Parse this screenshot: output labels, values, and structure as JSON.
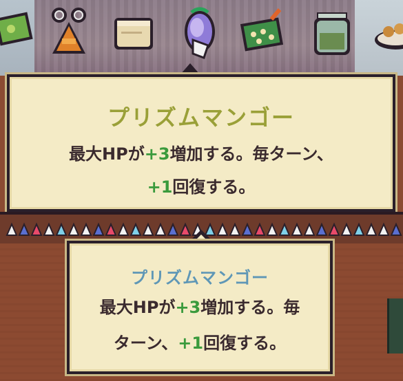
{
  "items": [
    {
      "name": "green-card-icon"
    },
    {
      "name": "scissors-ticket-icon"
    },
    {
      "name": "parchment-scroll-icon"
    },
    {
      "name": "prism-mango-icon"
    },
    {
      "name": "flower-blanket-icon"
    },
    {
      "name": "jar-icon"
    },
    {
      "name": "cookie-plate-icon"
    }
  ],
  "tooltip_large": {
    "title": "プリズムマンゴー",
    "line1_pre": "最大HPが",
    "line1_value": "+3",
    "line1_post": "増加する。毎ターン、",
    "line2_value": "+1",
    "line2_post": "回復する。"
  },
  "tooltip_small": {
    "title": "プリズムマンゴー",
    "line1_pre": "最大HPが",
    "line1_value": "+3",
    "line1_post": "増加する。毎",
    "line2_pre": "ターン、",
    "line2_value": "+1",
    "line2_post": "回復する。"
  },
  "colors": {
    "title_large": "#9aa038",
    "title_small": "#5f97b6",
    "highlight_green": "#3a9a3c",
    "tooltip_bg": "#f4ebc6",
    "tooltip_border": "#2a1f2a"
  }
}
